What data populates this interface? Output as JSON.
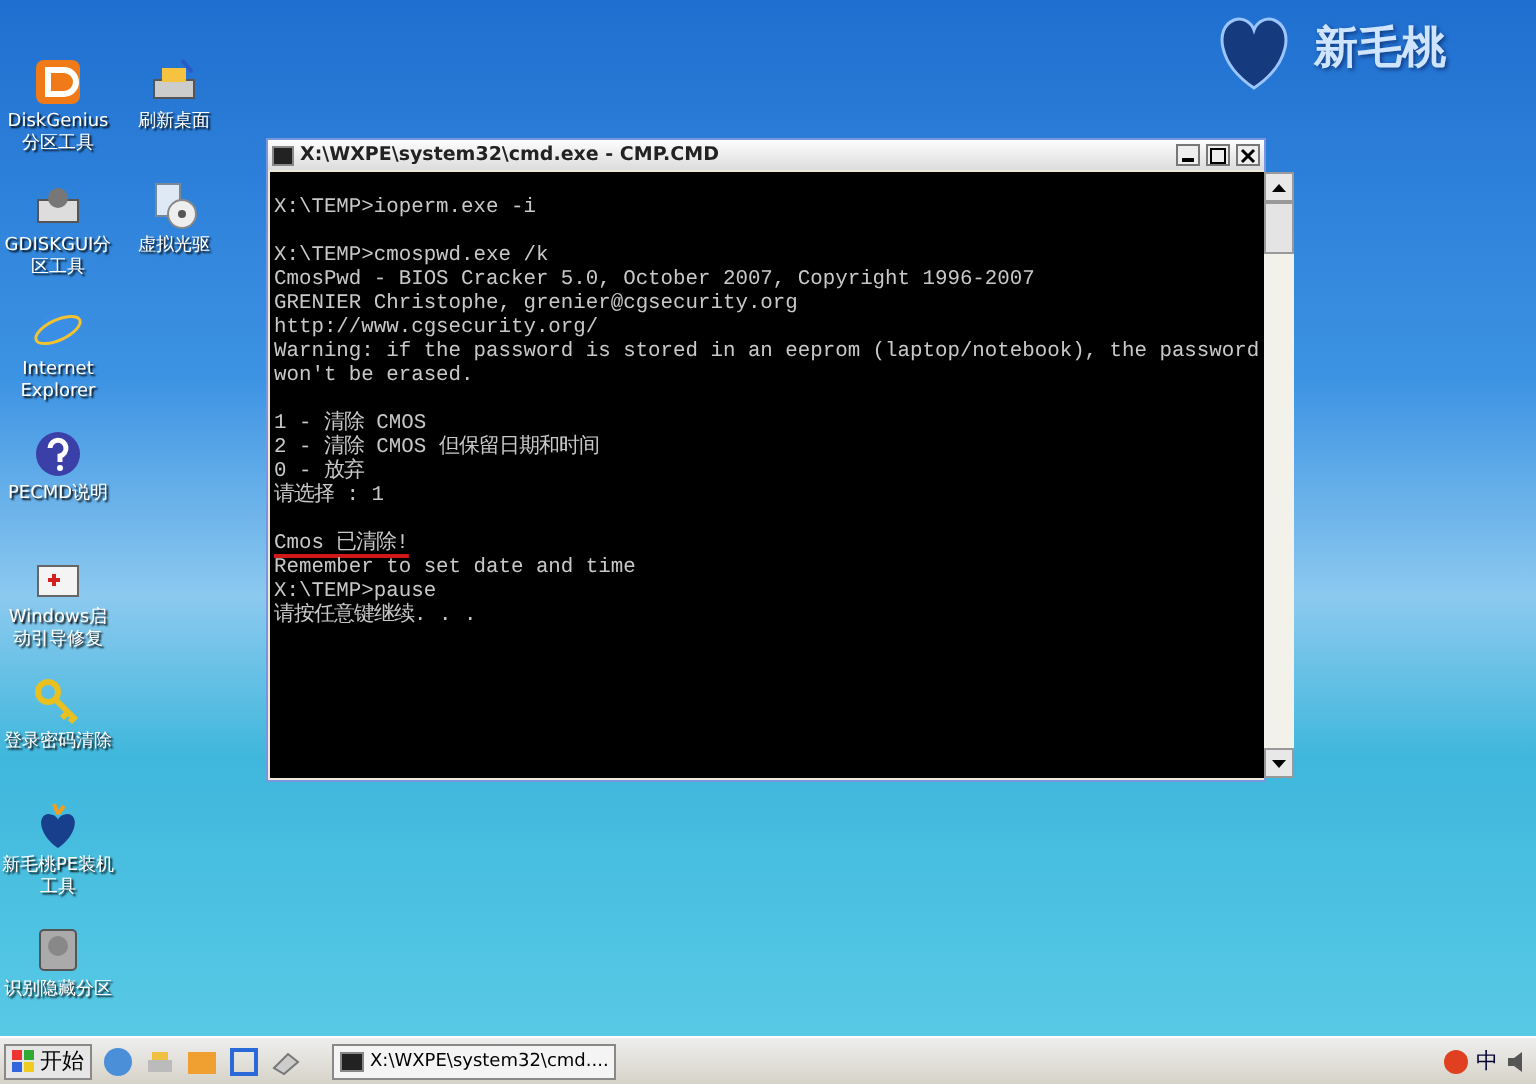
{
  "desktop_icon_columns": [
    [
      {
        "label": "DiskGenius分区工具",
        "kind": "disk"
      },
      {
        "label": "GDISKGUI分区工具",
        "kind": "tool"
      },
      {
        "label": "Internet Explorer",
        "kind": "ie"
      },
      {
        "label": "PECMD说明",
        "kind": "help"
      },
      {
        "label": "Windows启动引导修复",
        "kind": "kit"
      },
      {
        "label": "登录密码清除",
        "kind": "key"
      },
      {
        "label": "新毛桃PE装机工具",
        "kind": "peach"
      },
      {
        "label": "识别隐藏分区",
        "kind": "drive"
      }
    ],
    [
      {
        "label": "刷新桌面",
        "kind": "printer"
      },
      {
        "label": "虚拟光驱",
        "kind": "cd"
      }
    ]
  ],
  "logo": {
    "text": "新毛桃"
  },
  "console": {
    "title": "X:\\WXPE\\system32\\cmd.exe - CMP.CMD",
    "lines": [
      {
        "kind": "blank"
      },
      {
        "kind": "plain",
        "text": "X:\\TEMP>ioperm.exe -i"
      },
      {
        "kind": "blank"
      },
      {
        "kind": "plain",
        "text": "X:\\TEMP>cmospwd.exe /k"
      },
      {
        "kind": "plain",
        "text": "CmosPwd - BIOS Cracker 5.0, October 2007, Copyright 1996-2007"
      },
      {
        "kind": "plain",
        "text": "GRENIER Christophe, grenier@cgsecurity.org"
      },
      {
        "kind": "plain",
        "text": "http://www.cgsecurity.org/"
      },
      {
        "kind": "plain",
        "text": "Warning: if the password is stored in an eeprom (laptop/notebook), the password"
      },
      {
        "kind": "plain",
        "text": "won't be erased."
      },
      {
        "kind": "blank"
      },
      {
        "kind": "plain",
        "text": "1 - 清除 CMOS"
      },
      {
        "kind": "plain",
        "text": "2 - 清除 CMOS 但保留日期和时间"
      },
      {
        "kind": "plain",
        "text": "0 - 放弃"
      },
      {
        "kind": "plain",
        "text": "请选择 : 1"
      },
      {
        "kind": "blank"
      },
      {
        "kind": "marked",
        "text": "Cmos 已清除!"
      },
      {
        "kind": "plain",
        "text": "Remember to set date and time"
      },
      {
        "kind": "plain",
        "text": "X:\\TEMP>pause"
      },
      {
        "kind": "plain",
        "text": "请按任意键继续. . ."
      }
    ]
  },
  "taskbar": {
    "start_label": "开始",
    "tasks": [
      {
        "label": "X:\\WXPE\\system32\\cmd....",
        "selected": false
      }
    ],
    "tray_text": "中"
  }
}
